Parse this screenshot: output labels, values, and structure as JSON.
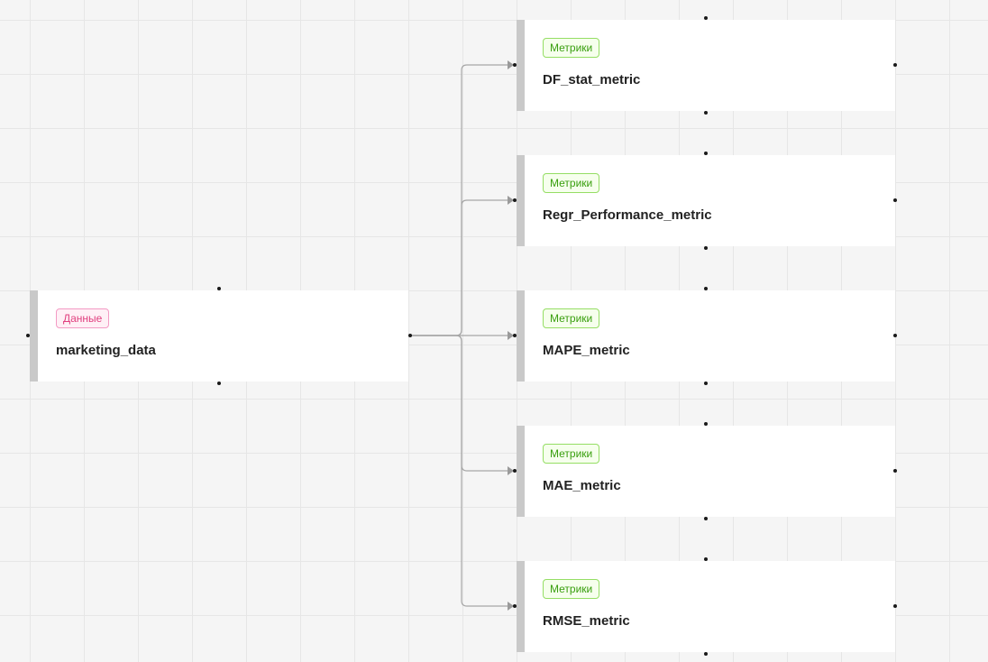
{
  "source": {
    "tag": "Данные",
    "title": "marketing_data"
  },
  "targets": [
    {
      "tag": "Метрики",
      "title": "DF_stat_metric"
    },
    {
      "tag": "Метрики",
      "title": "Regr_Performance_metric"
    },
    {
      "tag": "Метрики",
      "title": "MAPE_metric"
    },
    {
      "tag": "Метрики",
      "title": "MAE_metric"
    },
    {
      "tag": "Метрики",
      "title": "RMSE_metric"
    }
  ],
  "edges": [
    {
      "from": "marketing_data",
      "to": "DF_stat_metric"
    },
    {
      "from": "marketing_data",
      "to": "Regr_Performance_metric"
    },
    {
      "from": "marketing_data",
      "to": "MAPE_metric"
    },
    {
      "from": "marketing_data",
      "to": "MAE_metric"
    },
    {
      "from": "marketing_data",
      "to": "RMSE_metric"
    }
  ],
  "colors": {
    "canvas_background": "#f5f5f5",
    "grid_line": "#e6e6e6",
    "node_background": "#ffffff",
    "node_accent_bar": "#c9c9c9",
    "edge_line": "#a6a6a6",
    "data_tag_text": "#e0407f",
    "metric_tag_text": "#389e0d"
  }
}
